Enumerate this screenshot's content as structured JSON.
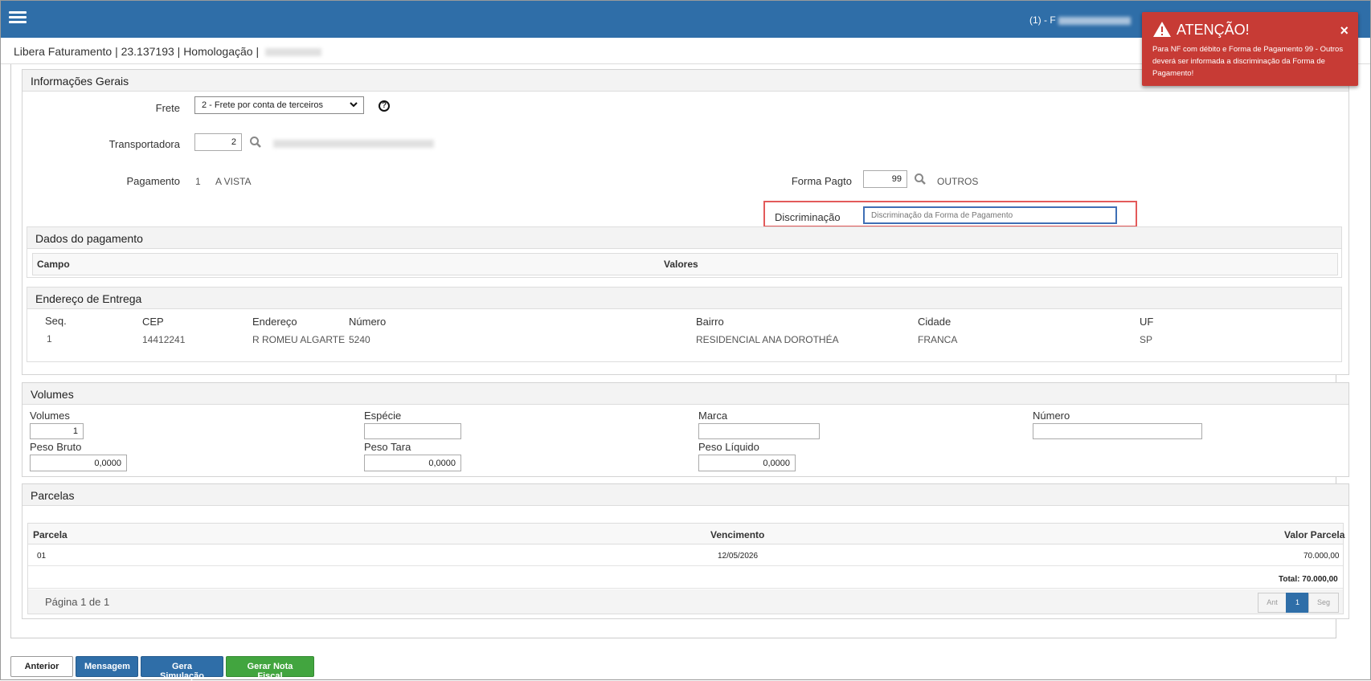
{
  "topbar": {
    "user_prefix": "(1) - F"
  },
  "breadcrumb": "Libera Faturamento | 23.137193 | Homologação |",
  "info_gerais": {
    "title": "Informações Gerais",
    "frete_label": "Frete",
    "frete_value": "2 - Frete por conta de terceiros",
    "transportadora_label": "Transportadora",
    "transportadora_value": "2",
    "pagamento_label": "Pagamento",
    "pagamento_code": "1",
    "pagamento_desc": "A VISTA",
    "forma_pagto_label": "Forma Pagto",
    "forma_pagto_value": "99",
    "forma_pagto_desc": "OUTROS",
    "discriminacao_label": "Discriminação",
    "discriminacao_placeholder": "Discriminação da Forma de Pagamento"
  },
  "dados_pagamento": {
    "title": "Dados do pagamento",
    "col_campo": "Campo",
    "col_valores": "Valores"
  },
  "endereco": {
    "title": "Endereço de Entrega",
    "headers": [
      "Seq.",
      "CEP",
      "Endereço",
      "Número",
      "Bairro",
      "Cidade",
      "UF"
    ],
    "row": [
      "1",
      "14412241",
      "R ROMEU ALGARTE",
      "5240",
      "RESIDENCIAL ANA DOROTHÉA",
      "FRANCA",
      "SP"
    ]
  },
  "volumes": {
    "title": "Volumes",
    "volumes_label": "Volumes",
    "volumes_value": "1",
    "especie_label": "Espécie",
    "especie_value": "",
    "marca_label": "Marca",
    "marca_value": "",
    "numero_label": "Número",
    "numero_value": "",
    "peso_bruto_label": "Peso Bruto",
    "peso_bruto_value": "0,0000",
    "peso_tara_label": "Peso Tara",
    "peso_tara_value": "0,0000",
    "peso_liquido_label": "Peso Líquido",
    "peso_liquido_value": "0,0000"
  },
  "parcelas": {
    "title": "Parcelas",
    "col_parcela": "Parcela",
    "col_vencimento": "Vencimento",
    "col_valor": "Valor Parcela",
    "row_parcela": "01",
    "row_vencimento": "12/05/2026",
    "row_valor": "70.000,00",
    "total": "Total: 70.000,00",
    "pagina": "Página 1 de 1",
    "pager_prev": "Ant",
    "pager_current": "1",
    "pager_next": "Seg"
  },
  "buttons": {
    "anterior": "Anterior",
    "mensagem": "Mensagem",
    "gera_simulacao": "Gera Simulação",
    "gerar_nota": "Gerar Nota Fiscal"
  },
  "alert": {
    "title": "ATENÇÃO!",
    "message": "Para NF com débito e Forma de Pagamento 99 - Outros deverá ser informada a discriminação da Forma de Pagamento!",
    "close": "×"
  },
  "colors": {
    "header_blue": "#2f6ea8",
    "alert_red": "#c73b35",
    "highlight_red": "#e35a5a",
    "button_green": "#42a53f"
  }
}
